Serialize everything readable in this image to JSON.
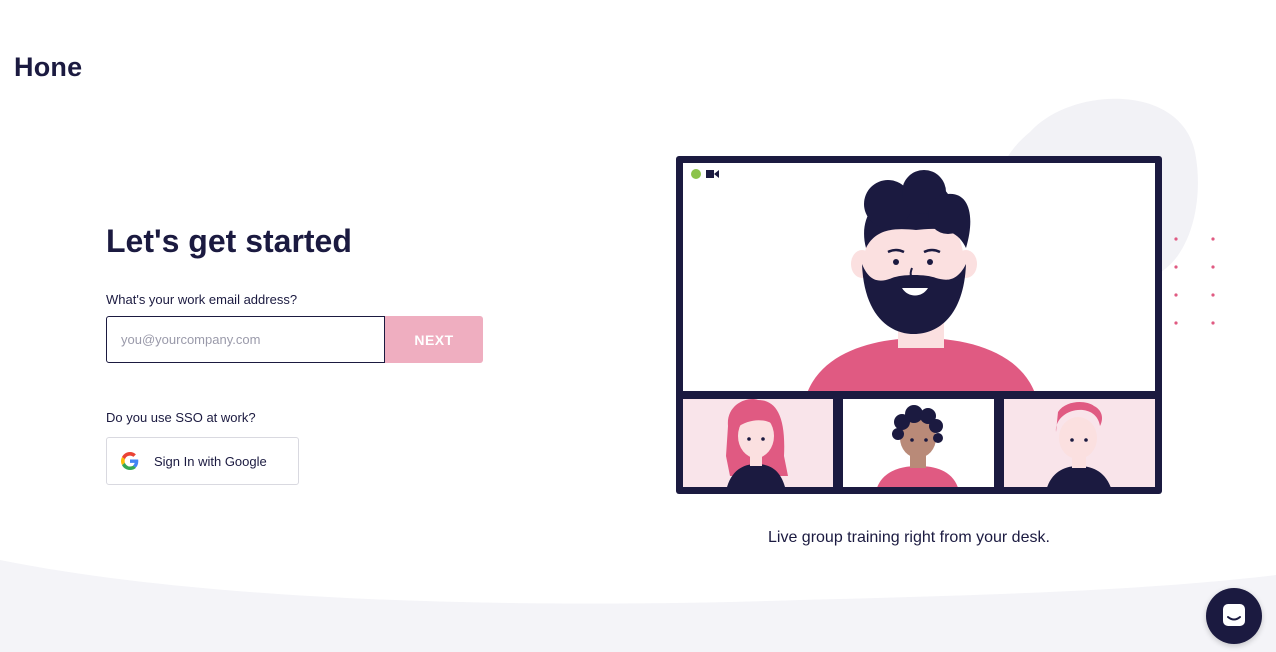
{
  "brand": {
    "logo_text": "Hone"
  },
  "signup": {
    "headline": "Let's get started",
    "email_label": "What's your work email address?",
    "email_placeholder": "you@yourcompany.com",
    "email_value": "",
    "next_label": "NEXT",
    "sso_label": "Do you use SSO at work?",
    "google_label": "Sign In with Google"
  },
  "illustration": {
    "caption": "Live group training right from your desk."
  },
  "colors": {
    "navy": "#1b1a40",
    "pink": "#e05a82",
    "pink_light": "#efaec0",
    "status_green": "#8bc34a"
  },
  "icons": [
    "google-icon",
    "camera-icon",
    "chat-icon"
  ]
}
